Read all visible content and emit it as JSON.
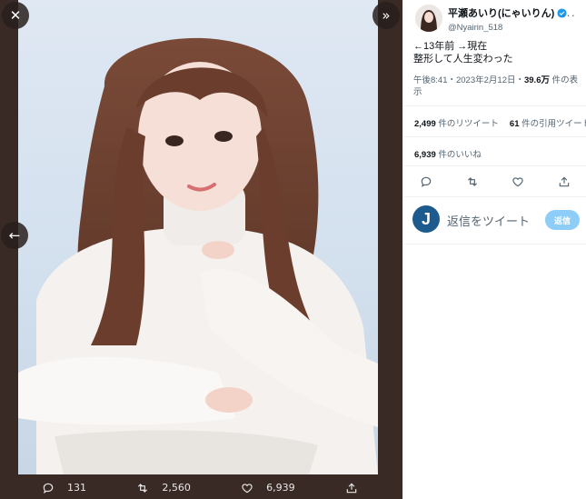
{
  "viewer": {
    "close_icon": "close-icon",
    "expand_icon": "expand-icon",
    "prev_icon": "arrow-left-icon",
    "actions": {
      "replies": "131",
      "retweets": "2,560",
      "likes": "6,939"
    }
  },
  "tweet": {
    "display_name": "平瀬あいり(にゃいりん)",
    "handle": "@Nyairin_518",
    "text_line1": "←13年前 →現在",
    "text_line2": "整形して人生変わった",
    "time_date": "午後8:41・2023年2月12日・",
    "views_value": "39.6万",
    "views_label": " 件の表示",
    "retweets_value": "2,499",
    "retweets_label": " 件のリツイート",
    "quotes_value": "61",
    "quotes_label": " 件の引用ツイート",
    "likes_value": "6,939",
    "likes_label": " 件のいいね"
  },
  "reply": {
    "avatar_letter": "J",
    "placeholder": "返信をツイート",
    "button_label": "返信"
  },
  "colors": {
    "viewer_bg": "#3a2a26",
    "accent": "#1d9bf0",
    "reply_button": "#8ecdf8",
    "muted_text": "#536471"
  }
}
